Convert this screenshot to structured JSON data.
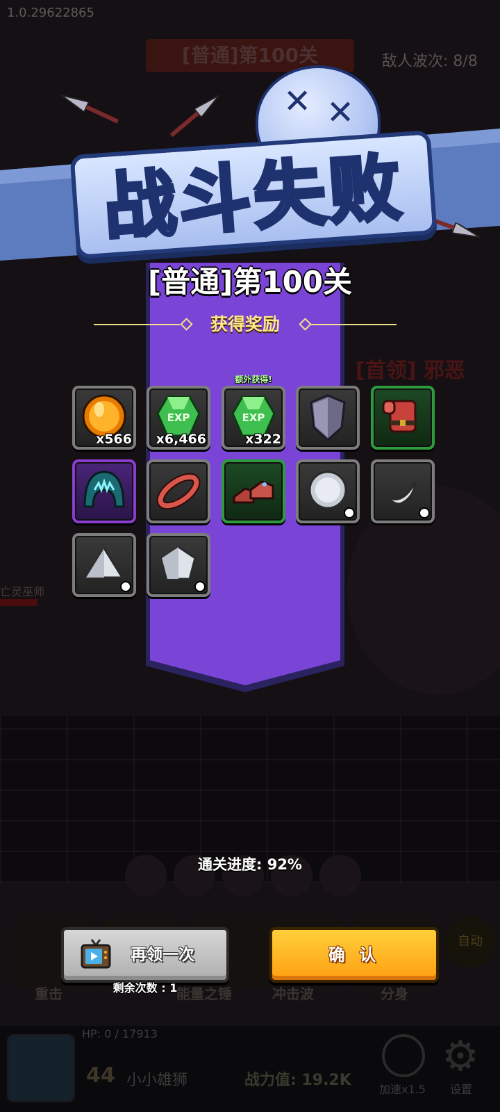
{
  "version": "1.0.29622865",
  "background": {
    "stage_plate": "[普通]第100关",
    "enemy_wave": "敌人波次: 8/8",
    "boss_label": "[首领] 邪恶",
    "enemy_label": "亡灵巫师",
    "skills": [
      "重击",
      "",
      "能量之锤",
      "冲击波",
      "分身"
    ],
    "auto_label": "自动",
    "player": {
      "hp": "HP: 0 / 17913",
      "level": "44",
      "name": "小小雄狮",
      "power": "战力值: 19.2K"
    },
    "speed_label": "加速x1.5",
    "settings_label": "设置"
  },
  "modal": {
    "title": "战斗失败",
    "stage": "[普通]第100关",
    "rewards_header": "获得奖励",
    "rewards": [
      {
        "icon": "gold-coin-icon",
        "quantity": "x566",
        "frame": "gray"
      },
      {
        "icon": "exp-gem-icon",
        "quantity": "x6,466",
        "frame": "gray"
      },
      {
        "icon": "exp-gem-icon",
        "quantity": "x322",
        "frame": "gray",
        "extra": "额外获得!"
      },
      {
        "icon": "shield-icon",
        "quantity": "",
        "frame": "gray"
      },
      {
        "icon": "red-armor-icon",
        "quantity": "",
        "frame": "green"
      },
      {
        "icon": "teal-hood-icon",
        "quantity": "",
        "frame": "purple"
      },
      {
        "icon": "red-ring-icon",
        "quantity": "",
        "frame": "gray"
      },
      {
        "icon": "red-boots-icon",
        "quantity": "",
        "frame": "green"
      },
      {
        "icon": "silver-orb-icon",
        "quantity": "",
        "frame": "gray"
      },
      {
        "icon": "silver-crescent-icon",
        "quantity": "",
        "frame": "gray"
      },
      {
        "icon": "silver-triangle-icon",
        "quantity": "",
        "frame": "gray"
      },
      {
        "icon": "silver-pentagon-icon",
        "quantity": "",
        "frame": "gray"
      }
    ],
    "progress": "通关进度: 92%",
    "retry_label": "再领一次",
    "retry_count": "剩余次数 : 1",
    "confirm_label": "确 认"
  },
  "colors": {
    "banner_purple": "#7a45d6",
    "title_blue": "#a9bff0",
    "confirm_orange": "#ffb01f",
    "frame_green": "#2d9a3d",
    "frame_purple": "#8a3ccf"
  }
}
